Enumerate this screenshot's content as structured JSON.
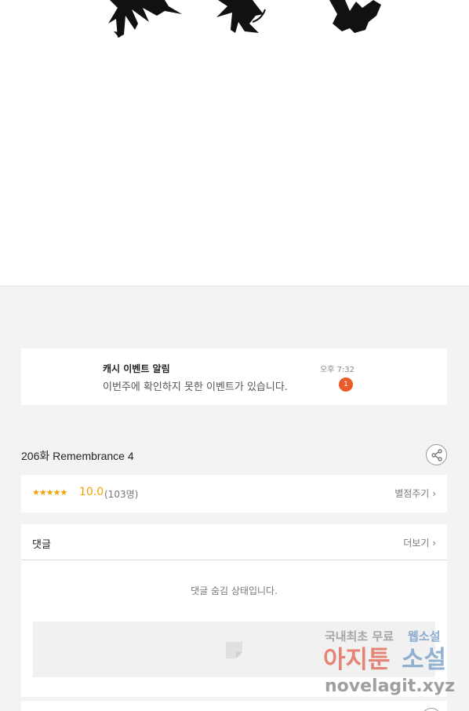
{
  "notice": {
    "title": "캐시 이벤트 알림",
    "message": "이번주에 확인하지 못한 이벤트가 있습니다.",
    "time": "오후 7:32",
    "badge": "1"
  },
  "episode": {
    "title": "206화 Remembrance 4",
    "share_icon": "share-icon"
  },
  "rating": {
    "stars": "★★★★★",
    "score": "10.0",
    "count": "(103명)",
    "rate_label": "별점주기",
    "chevron": "›"
  },
  "comments": {
    "title": "댓글",
    "more_label": "더보기",
    "chevron": "›",
    "hidden_message": "댓글 숨김 상태입니다."
  },
  "watermark": {
    "line1": "국내최초 무료 웹소설",
    "line2": "아지툰소설",
    "line3": "novelagit.xyz"
  },
  "colors": {
    "accent": "#f0a300",
    "badge": "#ea5a2b",
    "background": "#f2f3f5"
  }
}
